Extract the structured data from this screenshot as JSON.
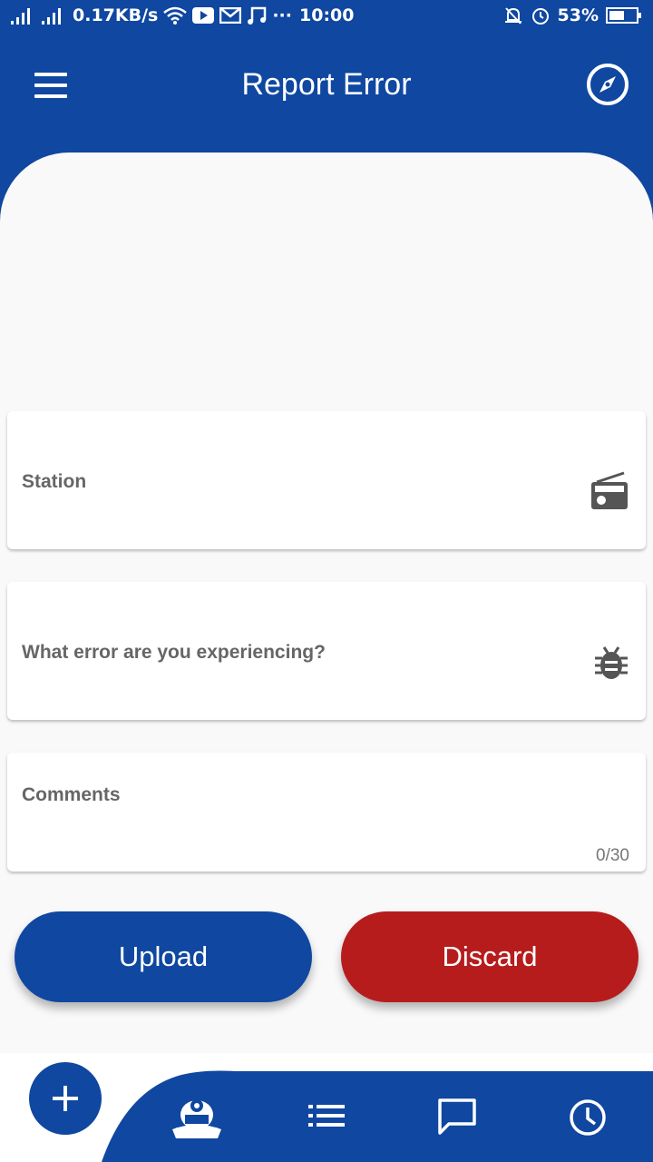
{
  "status_bar": {
    "network_speed": "0.17KB/s",
    "time": "10:00",
    "battery": "53%"
  },
  "app_bar": {
    "title": "Report Error"
  },
  "form": {
    "station_label": "Station",
    "error_label": "What error are you experiencing?",
    "comments_label": "Comments",
    "comments_counter": "0/30"
  },
  "actions": {
    "upload_label": "Upload",
    "discard_label": "Discard"
  },
  "bottom_nav": {
    "items": [
      "add-icon",
      "mascot-icon",
      "list-icon",
      "chat-icon",
      "clock-icon"
    ]
  },
  "colors": {
    "primary": "#0f47a1",
    "danger": "#b71c1c",
    "background": "#f9f9f9"
  }
}
